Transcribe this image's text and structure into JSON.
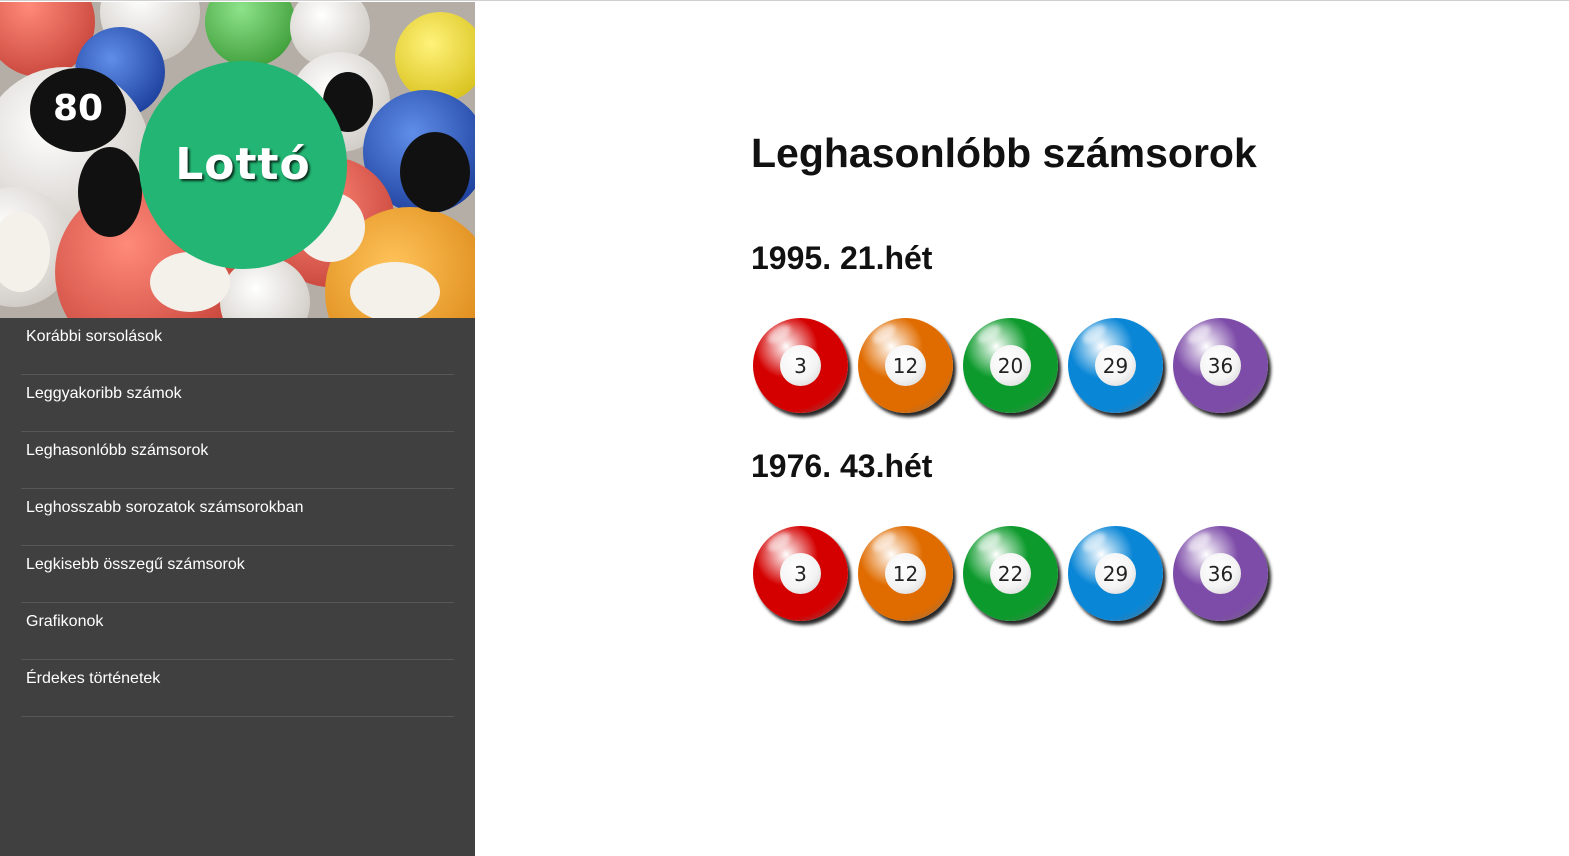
{
  "sidebar": {
    "logo_text": "Lottó",
    "logo_color": "#22b573",
    "background_color": "#404040",
    "hero_image": "lottery-balls-photo",
    "items": [
      {
        "label": "Korábbi sorsolások"
      },
      {
        "label": "Leggyakoribb számok"
      },
      {
        "label": "Leghasonlóbb számsorok"
      },
      {
        "label": "Leghosszabb sorozatok számsorokban"
      },
      {
        "label": "Legkisebb összegű számsorok"
      },
      {
        "label": "Grafikonok"
      },
      {
        "label": "Érdekes történetek"
      }
    ]
  },
  "main": {
    "title": "Leghasonlóbb számsorok",
    "draws": [
      {
        "label": "1995. 21.hét",
        "balls": [
          {
            "number": "3",
            "color": "#d40000"
          },
          {
            "number": "12",
            "color": "#e06c00"
          },
          {
            "number": "20",
            "color": "#0d9a2c"
          },
          {
            "number": "29",
            "color": "#0a86d6"
          },
          {
            "number": "36",
            "color": "#7d4ca8"
          }
        ]
      },
      {
        "label": "1976. 43.hét",
        "balls": [
          {
            "number": "3",
            "color": "#d40000"
          },
          {
            "number": "12",
            "color": "#e06c00"
          },
          {
            "number": "22",
            "color": "#0d9a2c"
          },
          {
            "number": "29",
            "color": "#0a86d6"
          },
          {
            "number": "36",
            "color": "#7d4ca8"
          }
        ]
      }
    ]
  }
}
